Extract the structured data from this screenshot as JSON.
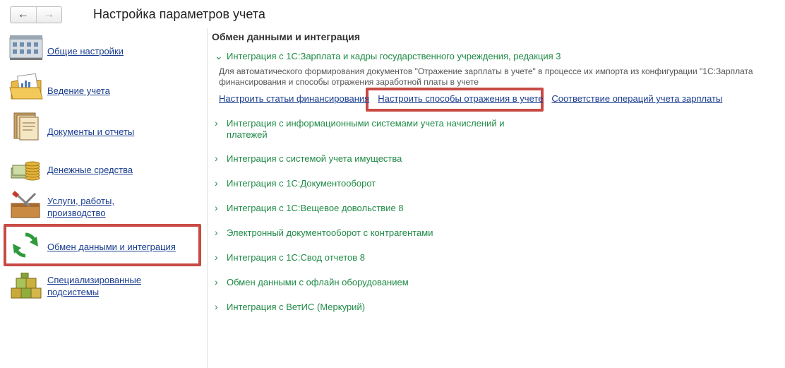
{
  "window": {
    "title": "Настройка параметров учета",
    "back_icon": "arrow-left-icon",
    "forward_icon": "arrow-right-icon"
  },
  "sidebar": {
    "items": [
      {
        "label_lines": [
          "Общие настройки"
        ],
        "icon": "building-icon"
      },
      {
        "label_lines": [
          "Ведение учета"
        ],
        "icon": "folder-chart-icon"
      },
      {
        "label_lines": [
          "Документы и отчеты"
        ],
        "icon": "documents-folder-icon"
      },
      {
        "label_lines": [
          "Денежные средства"
        ],
        "icon": "coins-icon"
      },
      {
        "label_lines": [
          "Услуги, работы,",
          "производство"
        ],
        "icon": "toolbox-icon"
      },
      {
        "label_lines": [
          "Обмен данными и интеграция"
        ],
        "icon": "sync-arrows-icon"
      },
      {
        "label_lines": [
          "Специализированные",
          "подсистемы"
        ],
        "icon": "cubes-icon"
      }
    ],
    "selected_index": 5
  },
  "main": {
    "section_title": "Обмен данными и интеграция",
    "expanded_group": {
      "title": "Интеграция с 1С:Зарплата и кадры государственного учреждения, редакция 3",
      "description_line1": "Для автоматического формирования документов \"Отражение зарплаты в учете\" в процессе их импорта из конфигурации \"1С:Зарплата",
      "description_line2": "финансирования и способы отражения заработной платы в учете",
      "links": [
        "Настроить статьи финансирования",
        "Настроить способы отражения в учете",
        "Соответствие операций учета зарплаты"
      ]
    },
    "collapsed_groups": [
      [
        "Интеграция с информационными системами учета начислений и",
        "платежей"
      ],
      [
        "Интеграция с системой учета имущества"
      ],
      [
        "Интеграция с 1С:Документооборот"
      ],
      [
        "Интеграция с 1С:Вещевое довольствие 8"
      ],
      [
        "Электронный документооборот с контрагентами"
      ],
      [
        "Интеграция с 1С:Свод отчетов 8"
      ],
      [
        "Обмен данными с офлайн оборудованием"
      ],
      [
        "Интеграция с ВетИС (Меркурий)"
      ]
    ],
    "expanded_chevron": "chevron-down-icon",
    "collapsed_chevron": "chevron-right-icon"
  },
  "colors": {
    "link": "#1a3d8f",
    "group_title": "#1f8a46",
    "highlight": "#c84a44"
  }
}
